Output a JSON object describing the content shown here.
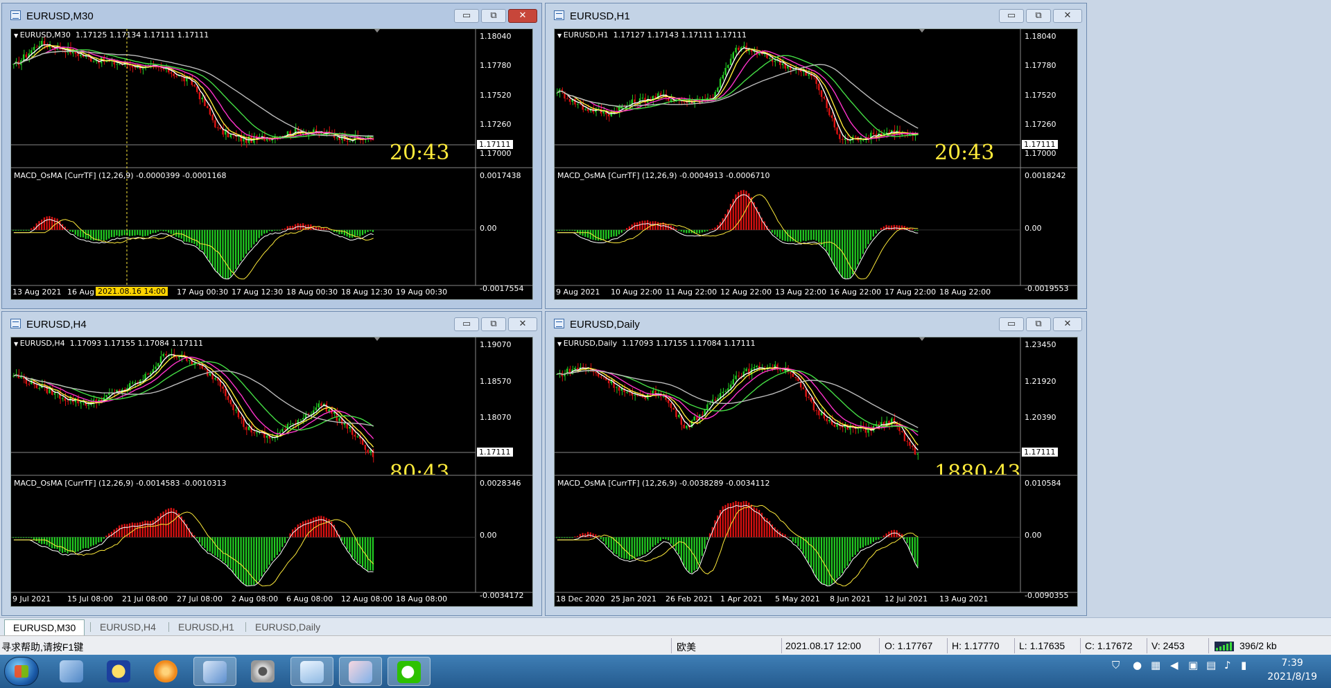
{
  "windows": [
    {
      "id": "m30",
      "title": "EURUSD,M30",
      "ohlc": "EURUSD,M30  1.17125 1.17134 1.17111 1.17111",
      "price_labels": [
        "1.18040",
        "1.17780",
        "1.17520",
        "1.17260",
        "1.17000"
      ],
      "current_price": "1.17111",
      "timer": "20:43",
      "macd_label": "MACD_OsMA [CurrTF] (12,26,9) -0.0000399 -0.0001168",
      "macd_labels": [
        "0.0017438",
        "0.00",
        "-0.0017554"
      ],
      "x_labels": [
        "13 Aug 2021",
        "16 Aug 0",
        "0",
        "17 Aug 00:30",
        "17 Aug 12:30",
        "18 Aug 00:30",
        "18 Aug 12:30",
        "19 Aug 00:30"
      ],
      "crosshair_label": "2021.08.16 14:00",
      "active": true
    },
    {
      "id": "h1",
      "title": "EURUSD,H1",
      "ohlc": "EURUSD,H1  1.17127 1.17143 1.17111 1.17111",
      "price_labels": [
        "1.18040",
        "1.17780",
        "1.17520",
        "1.17260",
        "1.17000"
      ],
      "current_price": "1.17111",
      "timer": "20:43",
      "macd_label": "MACD_OsMA [CurrTF] (12,26,9) -0.0004913 -0.0006710",
      "macd_labels": [
        "0.0018242",
        "0.00",
        "-0.0019553"
      ],
      "x_labels": [
        "9 Aug 2021",
        "10 Aug 22:00",
        "11 Aug 22:00",
        "12 Aug 22:00",
        "13 Aug 22:00",
        "16 Aug 22:00",
        "17 Aug 22:00",
        "18 Aug 22:00"
      ],
      "active": false
    },
    {
      "id": "h4",
      "title": "EURUSD,H4",
      "ohlc": "EURUSD,H4  1.17093 1.17155 1.17084 1.17111",
      "price_labels": [
        "1.19070",
        "1.18570",
        "1.18070",
        "1.17560"
      ],
      "current_price": "1.17111",
      "timer": "80:43",
      "macd_label": "MACD_OsMA [CurrTF] (12,26,9) -0.0014583 -0.0010313",
      "macd_labels": [
        "0.0028346",
        "0.00",
        "-0.0034172"
      ],
      "x_labels": [
        "9 Jul 2021",
        "15 Jul 08:00",
        "21 Jul 08:00",
        "27 Jul 08:00",
        "2 Aug 08:00",
        "6 Aug 08:00",
        "12 Aug 08:00",
        "18 Aug 08:00"
      ],
      "active": false
    },
    {
      "id": "daily",
      "title": "EURUSD,Daily",
      "ohlc": "EURUSD,Daily  1.17093 1.17155 1.17084 1.17111",
      "price_labels": [
        "1.23450",
        "1.21920",
        "1.20390",
        "1.18860"
      ],
      "current_price": "1.17111",
      "timer": "1880:43",
      "macd_label": "MACD_OsMA [CurrTF] (12,26,9) -0.0038289 -0.0034112",
      "macd_labels": [
        "0.010584",
        "0.00",
        "-0.0090355"
      ],
      "x_labels": [
        "18 Dec 2020",
        "25 Jan 2021",
        "26 Feb 2021",
        "1 Apr 2021",
        "5 May 2021",
        "8 Jun 2021",
        "12 Jul 2021",
        "13 Aug 2021"
      ],
      "active": false
    }
  ],
  "window_buttons": {
    "minimize": "▭",
    "restore": "⧉",
    "close": "✕"
  },
  "tabs": [
    "EURUSD,M30",
    "EURUSD,H4",
    "EURUSD,H1",
    "EURUSD,Daily"
  ],
  "status": {
    "help": "寻求帮助,请按F1键",
    "profile": "欧美",
    "datetime": "2021.08.17 12:00",
    "open": "O: 1.17767",
    "high": "H: 1.17770",
    "low": "L: 1.17635",
    "close": "C: 1.17672",
    "volume": "V: 2453",
    "traffic": "396/2 kb"
  },
  "clock": {
    "time": "7:39",
    "date": "2021/8/19"
  },
  "colors": {
    "chart_bg": "#000000",
    "bull": "#22cc22",
    "bear": "#dd1111",
    "ma_fast": "#ffffff",
    "ma_yellow": "#ffeb3b",
    "ma_magenta": "#ff33cc",
    "ma_green": "#44dd44",
    "ma_gray": "#bbbbbb",
    "timer": "#ffeb3b"
  },
  "taskbar_icons": [
    "explorer-icon",
    "dollar-icon",
    "refresh-orange-icon",
    "metatrader-icon",
    "camera-icon",
    "notepad-icon",
    "paint-icon",
    "wechat-icon"
  ]
}
